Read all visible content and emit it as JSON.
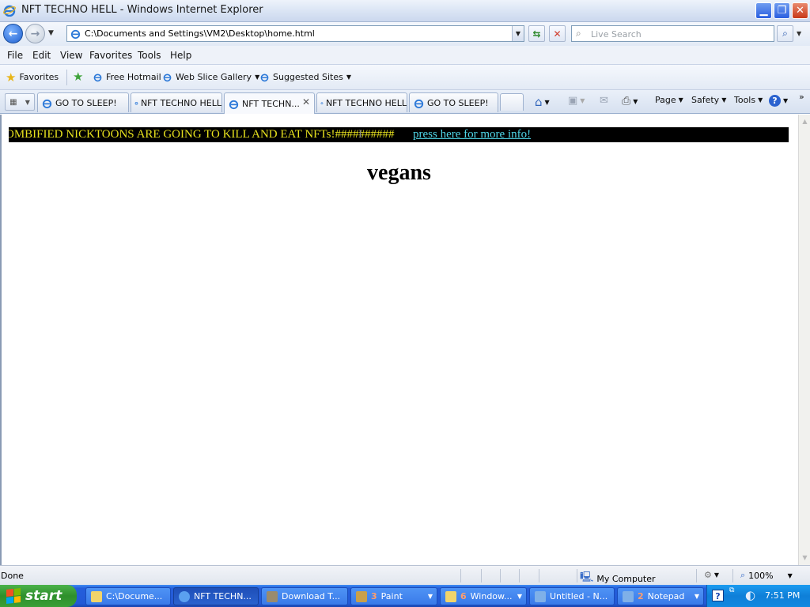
{
  "window": {
    "title": "NFT TECHNO HELL - Windows Internet Explorer"
  },
  "address_bar": {
    "url": "C:\\Documents and Settings\\VM2\\Desktop\\home.html",
    "search_placeholder": "Live Search"
  },
  "menu": [
    "File",
    "Edit",
    "View",
    "Favorites",
    "Tools",
    "Help"
  ],
  "favorites_bar": {
    "favorites_label": "Favorites",
    "links": [
      "Free Hotmail",
      "Web Slice Gallery",
      "Suggested Sites"
    ]
  },
  "tabs": [
    {
      "label": "GO TO SLEEP!",
      "active": false
    },
    {
      "label": "NFT TECHNO HELL",
      "active": false
    },
    {
      "label": "NFT TECHN...",
      "active": true
    },
    {
      "label": "NFT TECHNO HELL",
      "active": false
    },
    {
      "label": "GO TO SLEEP!",
      "active": false
    }
  ],
  "command_bar": {
    "page": "Page",
    "safety": "Safety",
    "tools": "Tools"
  },
  "page": {
    "marquee_text": "OMBIFIED NICKTOONS ARE GOING TO KILL AND EAT NFTs!##########",
    "marquee_link": "press here for more info!",
    "heading": "vegans",
    "marquee_bg": "#000000",
    "marquee_text_color": "#e8e21e",
    "marquee_link_color": "#4fd6e8"
  },
  "status_bar": {
    "status": "Done",
    "zone": "My Computer",
    "zoom": "100%"
  },
  "taskbar": {
    "start_label": "start",
    "buttons": [
      {
        "label": "C:\\Docume...",
        "count": "",
        "active": false
      },
      {
        "label": "NFT TECHN...",
        "count": "",
        "active": true
      },
      {
        "label": "Download T...",
        "count": "",
        "active": false
      },
      {
        "label": "Paint",
        "count": "3",
        "active": false
      },
      {
        "label": "Window...",
        "count": "6",
        "active": false
      },
      {
        "label": "Untitled - N...",
        "count": "",
        "active": false
      },
      {
        "label": "Notepad",
        "count": "2",
        "active": false
      }
    ],
    "clock": "7:51 PM"
  }
}
